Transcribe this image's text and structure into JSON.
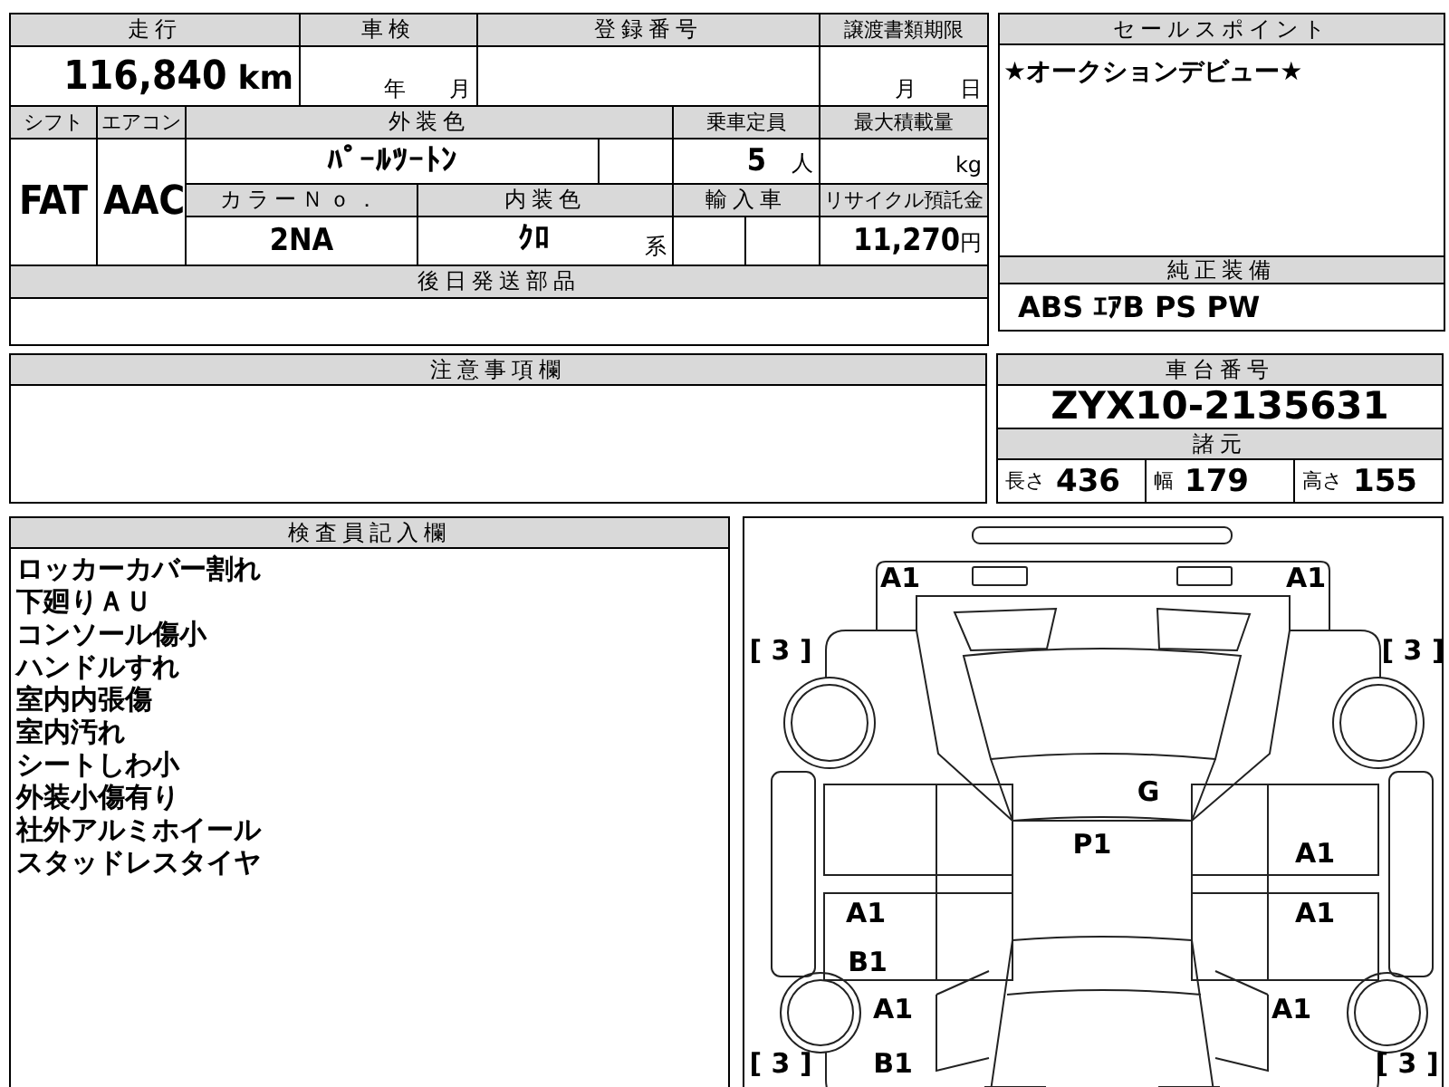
{
  "top_table": {
    "mileage": {
      "label": "走行",
      "value": "116,840",
      "unit": "km"
    },
    "inspection": {
      "label": "車検",
      "year_unit": "年",
      "month_unit": "月"
    },
    "registration": {
      "label": "登録番号"
    },
    "transfer_deadline": {
      "label": "譲渡書類期限",
      "month_unit": "月",
      "day_unit": "日"
    },
    "shift": {
      "label": "シフト",
      "value": "FAT"
    },
    "aircon": {
      "label": "エアコン",
      "value": "AAC"
    },
    "exterior_color": {
      "label": "外装色",
      "value": "ﾊﾟｰﾙﾂｰﾄﾝ"
    },
    "capacity": {
      "label": "乗車定員",
      "value": "5",
      "unit": "人"
    },
    "max_load": {
      "label": "最大積載量",
      "unit": "kg"
    },
    "color_no": {
      "label": "カラーＮｏ．",
      "value": "2NA"
    },
    "interior_color": {
      "label": "内装色",
      "value": "ｸﾛ",
      "suffix": "系"
    },
    "imported": {
      "label": "輸入車"
    },
    "recycle_fee": {
      "label": "リサイクル預託金",
      "value": "11,270",
      "unit": "円"
    },
    "parts_later": {
      "label": "後日発送部品"
    }
  },
  "sale_points": {
    "label": "セールスポイント",
    "text": "★オークションデビュー★"
  },
  "equipment": {
    "label": "純正装備",
    "value": "ABS ｴｱB PS PW"
  },
  "notes": {
    "label": "注意事項欄"
  },
  "chassis": {
    "label": "車台番号",
    "value": "ZYX10-2135631"
  },
  "specs": {
    "label": "諸元",
    "items": [
      {
        "label": "長さ",
        "value": "436"
      },
      {
        "label": "幅",
        "value": "179"
      },
      {
        "label": "高さ",
        "value": "155"
      }
    ]
  },
  "inspector": {
    "label": "検査員記入欄",
    "lines": [
      "ロッカーカバー割れ",
      "下廻りＡＵ",
      "コンソール傷小",
      "ハンドルすれ",
      "室内内張傷",
      "室内汚れ",
      "シートしわ小",
      "外装小傷有り",
      "社外アルミホイール",
      "スタッドレスタイヤ"
    ]
  },
  "diagram": {
    "marks": [
      "A1",
      "A1",
      "[ 3 ]",
      "[ 3 ]",
      "G",
      "P1",
      "A1",
      "A1",
      "A1",
      "B1",
      "A1",
      "A1",
      "[ 3 ]",
      "B1",
      "[ 3 ]"
    ]
  }
}
